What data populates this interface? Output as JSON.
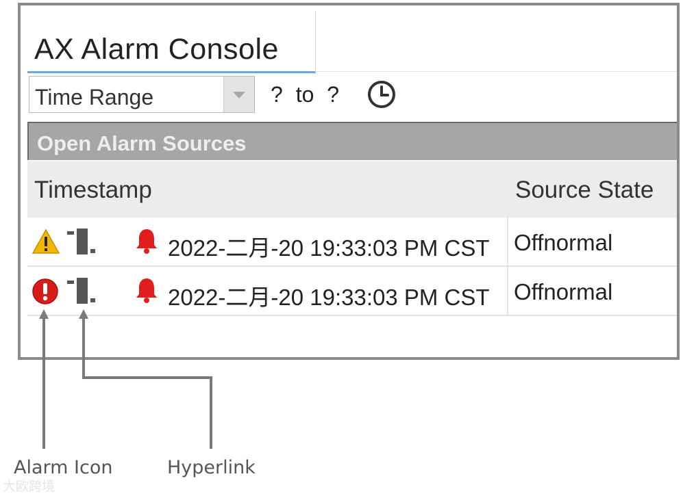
{
  "app": {
    "title": "AX Alarm Console"
  },
  "toolbar": {
    "time_range_label": "Time Range",
    "from": "?",
    "to_word": "to",
    "to": "?"
  },
  "section": {
    "title": "Open Alarm Sources"
  },
  "table": {
    "columns": [
      "Timestamp",
      "Source State"
    ],
    "rows": [
      {
        "alarm_icon": "warning-triangle-icon",
        "timestamp": "2022-二月-20 19:33:03 PM CST",
        "source_state": "Offnormal"
      },
      {
        "alarm_icon": "error-circle-icon",
        "timestamp": "2022-二月-20 19:33:03 PM CST",
        "source_state": "Offnormal"
      }
    ]
  },
  "legend": {
    "alarm_icon": "Alarm Icon",
    "hyperlink": "Hyperlink"
  },
  "watermark": "大欧跨境",
  "colors": {
    "tab_underline": "#6aa8e0",
    "alarm_red": "#e01e1e",
    "warning_yellow": "#f2b500",
    "header_bar": "#a6a6a6"
  }
}
